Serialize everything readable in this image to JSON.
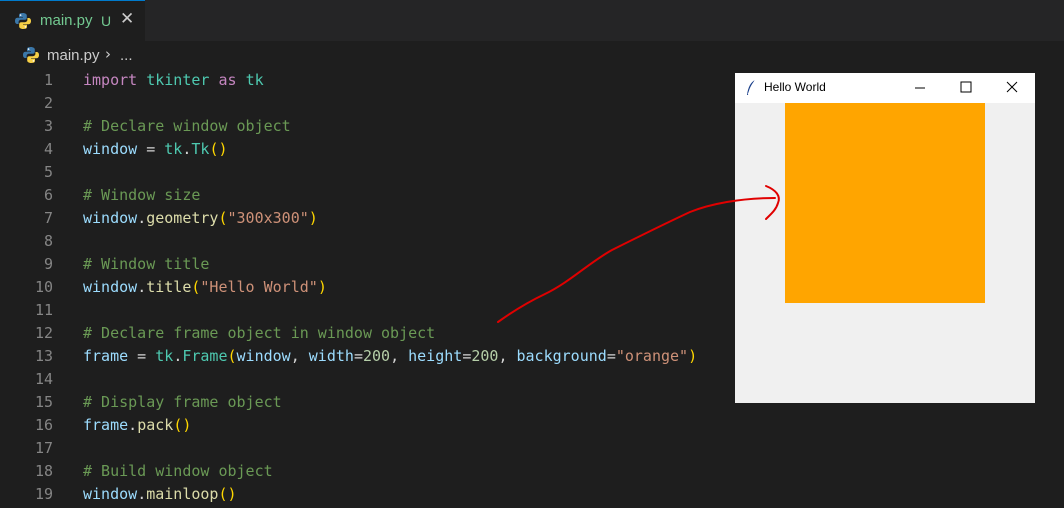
{
  "tab": {
    "filename": "main.py",
    "badge": "U",
    "close_glyph": "✕"
  },
  "breadcrumb": {
    "file": "main.py",
    "separator": "›",
    "more": "..."
  },
  "editor": {
    "line_numbers": [
      "1",
      "2",
      "3",
      "4",
      "5",
      "6",
      "7",
      "8",
      "9",
      "10",
      "11",
      "12",
      "13",
      "14",
      "15",
      "16",
      "17",
      "18",
      "19"
    ],
    "lines": {
      "l1": [
        "import",
        " ",
        "tkinter",
        " ",
        "as",
        " ",
        "tk"
      ],
      "l3": "# Declare window object",
      "l4": [
        "window",
        " = ",
        "tk",
        ".",
        "Tk",
        "(",
        ")"
      ],
      "l6": "# Window size",
      "l7": [
        "window",
        ".",
        "geometry",
        "(",
        "\"300x300\"",
        ")"
      ],
      "l9": "# Window title",
      "l10": [
        "window",
        ".",
        "title",
        "(",
        "\"Hello World\"",
        ")"
      ],
      "l12": "# Declare frame object in window object",
      "l13": [
        "frame",
        " = ",
        "tk",
        ".",
        "Frame",
        "(",
        "window",
        ", ",
        "width",
        "=",
        "200",
        ", ",
        "height",
        "=",
        "200",
        ", ",
        "background",
        "=",
        "\"orange\"",
        ")"
      ],
      "l15": "# Display frame object",
      "l16": [
        "frame",
        ".",
        "pack",
        "(",
        ")"
      ],
      "l18": "# Build window object",
      "l19": [
        "window",
        ".",
        "mainloop",
        "(",
        ")"
      ]
    }
  },
  "tk_window": {
    "title": "Hello World",
    "frame_color": "#ffa500",
    "buttons": [
      "minimize",
      "maximize",
      "close"
    ]
  },
  "annotation": {
    "color": "#e00000"
  },
  "icons": {
    "tab_icon": "python-icon",
    "breadcrumb_icon": "python-icon",
    "window_icon": "tk-feather-icon"
  }
}
